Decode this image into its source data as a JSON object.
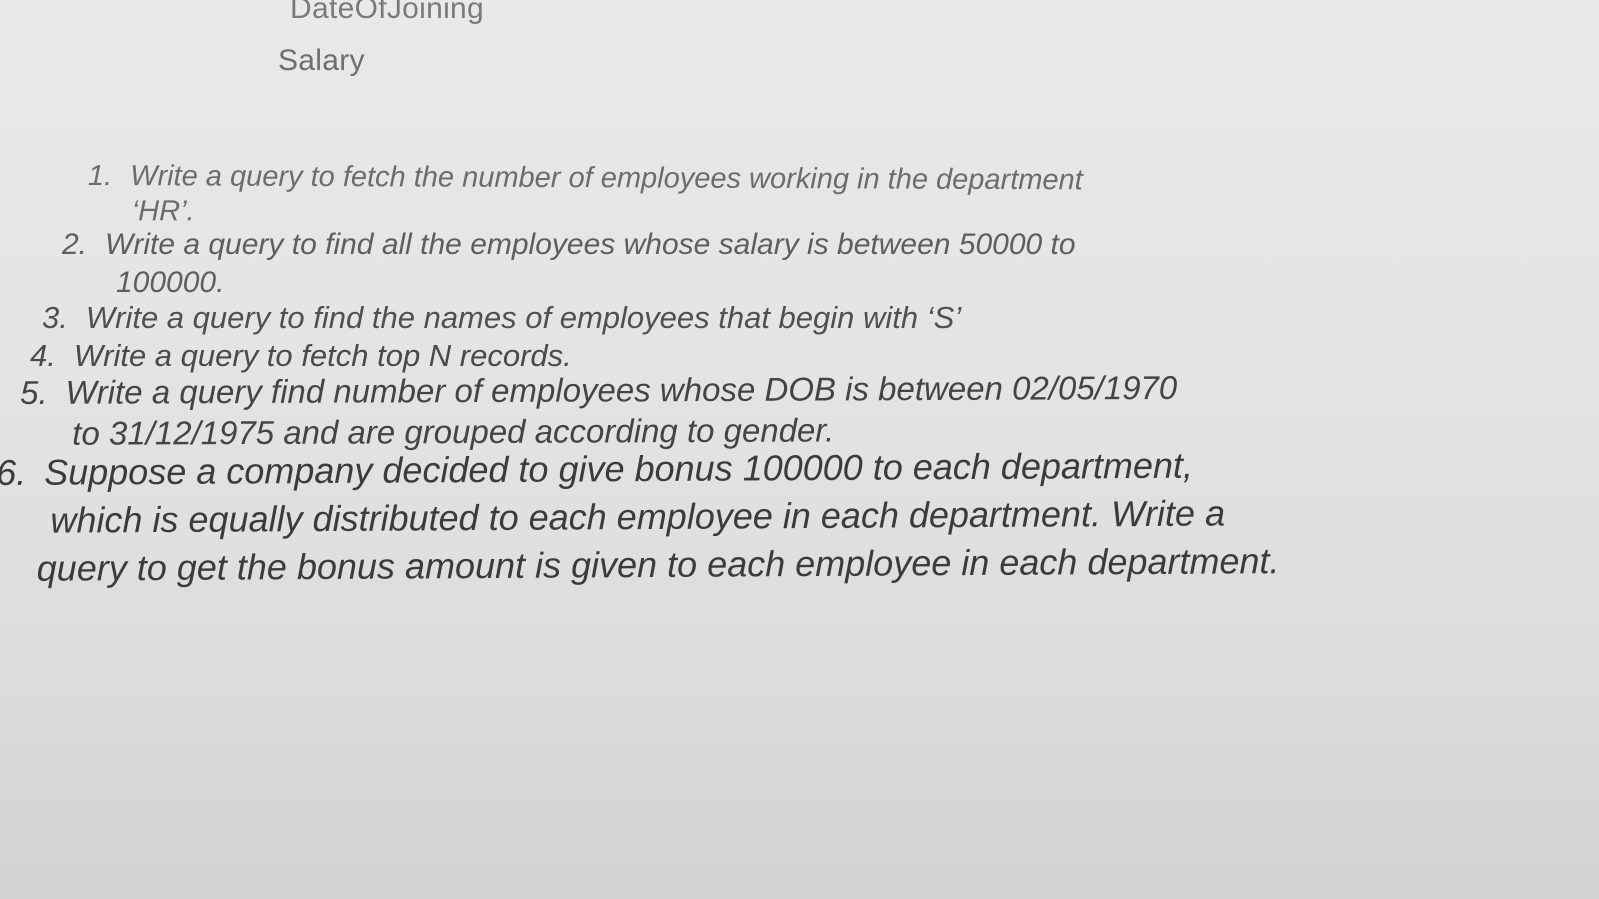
{
  "fields": [
    "DateOfJoining",
    "Salary"
  ],
  "questions": [
    {
      "number": "1.",
      "lines": [
        "Write a query to fetch the number of employees working in the department",
        "‘HR’."
      ]
    },
    {
      "number": "2.",
      "lines": [
        "Write a query to find all the employees whose salary is between 50000 to",
        "100000."
      ]
    },
    {
      "number": "3.",
      "lines": [
        "Write a query to find the names of employees that begin with ‘S’"
      ]
    },
    {
      "number": "4.",
      "lines": [
        "Write a query to fetch top N records."
      ]
    },
    {
      "number": "5.",
      "lines": [
        "Write a query find number of employees whose DOB is between 02/05/1970",
        "to 31/12/1975 and are grouped according to gender."
      ]
    },
    {
      "number": "6.",
      "lines": [
        "Suppose a company decided to give bonus 100000 to each department,",
        "which is equally distributed to each employee in each department. Write a",
        "query to get the bonus amount is given to each employee in each department."
      ]
    }
  ]
}
